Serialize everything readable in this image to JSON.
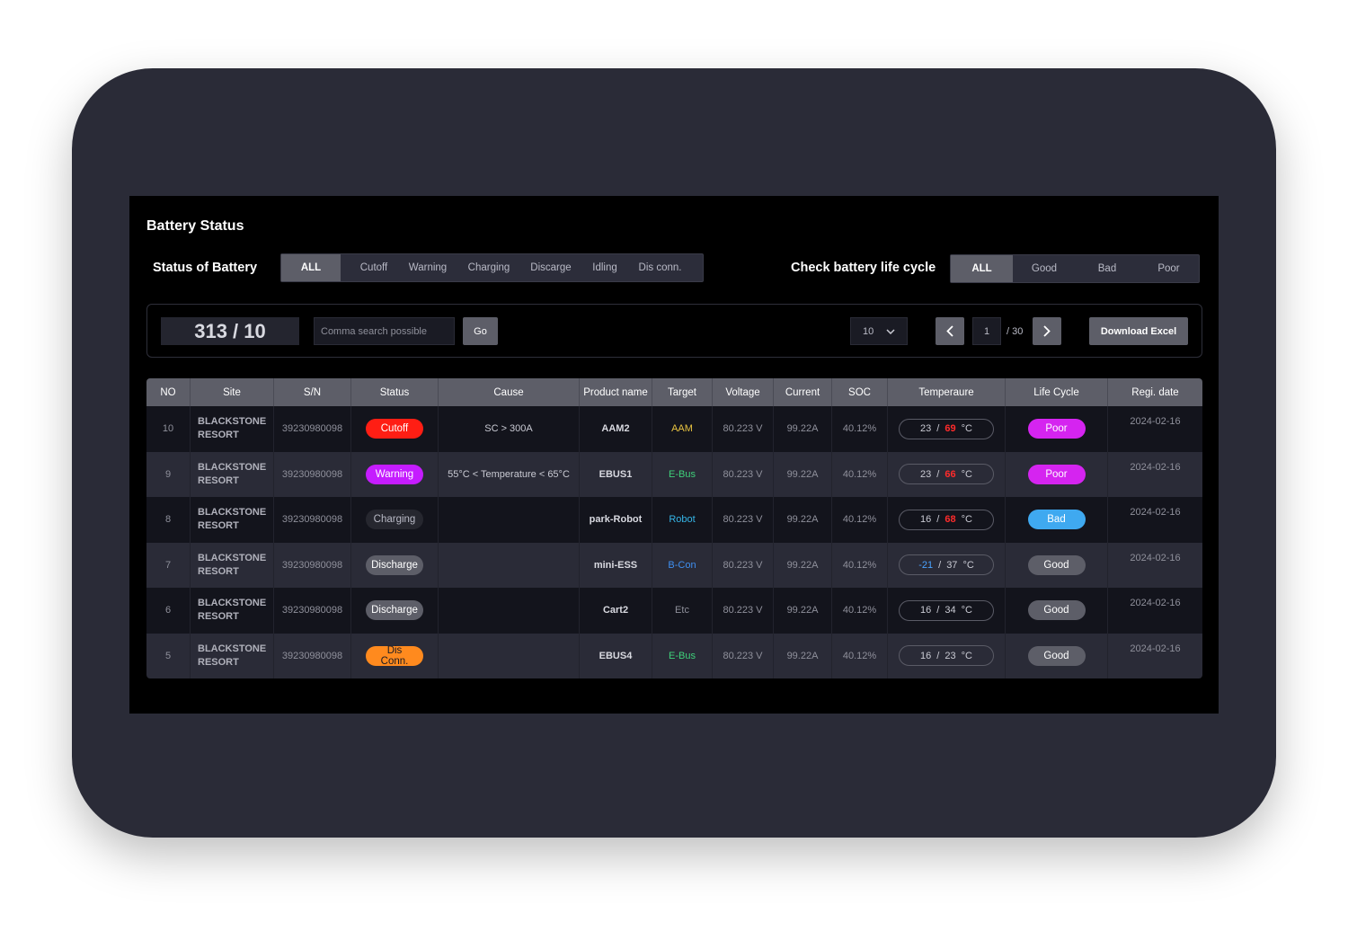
{
  "title": "Battery Status",
  "status_filter": {
    "label": "Status of Battery",
    "options": [
      "ALL",
      "Cutoff",
      "Warning",
      "Charging",
      "Discarge",
      "Idling",
      "Dis conn."
    ]
  },
  "life_filter": {
    "label": "Check battery life cycle",
    "options": [
      "ALL",
      "Good",
      "Bad",
      "Poor"
    ]
  },
  "toolbar": {
    "count": "313 / 10",
    "search_placeholder": "Comma search possible",
    "go_label": "Go",
    "per_page": "10",
    "page": "1",
    "total_pages": "/ 30",
    "download_label": "Download Excel"
  },
  "table": {
    "headers": [
      "NO",
      "Site",
      "S/N",
      "Status",
      "Cause",
      "Product name",
      "Target",
      "Voltage",
      "Current",
      "SOC",
      "Temperaure",
      "Life Cycle",
      "Regi. date"
    ],
    "rows": [
      {
        "no": "10",
        "site1": "BLACKSTONE",
        "site2": "RESORT",
        "sn": "39230980098",
        "status": "Cutoff",
        "cause": "SC > 300A",
        "product": "AAM2",
        "target": "AAM",
        "voltage": "80.223 V",
        "current": "99.22A",
        "soc": "40.12%",
        "t1": "23",
        "sep": "/",
        "t2": "69",
        "unit": "°C",
        "life": "Poor",
        "date": "2024-02-16"
      },
      {
        "no": "9",
        "site1": "BLACKSTONE",
        "site2": "RESORT",
        "sn": "39230980098",
        "status": "Warning",
        "cause": "55°C < Temperature < 65°C",
        "product": "EBUS1",
        "target": "E-Bus",
        "voltage": "80.223 V",
        "current": "99.22A",
        "soc": "40.12%",
        "t1": "23",
        "sep": "/",
        "t2": "66",
        "unit": "°C",
        "life": "Poor",
        "date": "2024-02-16"
      },
      {
        "no": "8",
        "site1": "BLACKSTONE",
        "site2": "RESORT",
        "sn": "39230980098",
        "status": "Charging",
        "cause": "",
        "product": "park-Robot",
        "target": "Robot",
        "voltage": "80.223 V",
        "current": "99.22A",
        "soc": "40.12%",
        "t1": "16",
        "sep": "/",
        "t2": "68",
        "unit": "°C",
        "life": "Bad",
        "date": "2024-02-16"
      },
      {
        "no": "7",
        "site1": "BLACKSTONE",
        "site2": "RESORT",
        "sn": "39230980098",
        "status": "Discharge",
        "cause": "",
        "product": "mini-ESS",
        "target": "B-Con",
        "voltage": "80.223 V",
        "current": "99.22A",
        "soc": "40.12%",
        "t1": "-21",
        "sep": "/",
        "t2": "37",
        "unit": "°C",
        "life": "Good",
        "date": "2024-02-16"
      },
      {
        "no": "6",
        "site1": "BLACKSTONE",
        "site2": "RESORT",
        "sn": "39230980098",
        "status": "Discharge",
        "cause": "",
        "product": "Cart2",
        "target": "Etc",
        "voltage": "80.223 V",
        "current": "99.22A",
        "soc": "40.12%",
        "t1": "16",
        "sep": "/",
        "t2": "34",
        "unit": "°C",
        "life": "Good",
        "date": "2024-02-16"
      },
      {
        "no": "5",
        "site1": "BLACKSTONE",
        "site2": "RESORT",
        "sn": "39230980098",
        "status": "Dis Conn.",
        "cause": "",
        "product": "EBUS4",
        "target": "E-Bus",
        "voltage": "80.223 V",
        "current": "99.22A",
        "soc": "40.12%",
        "t1": "16",
        "sep": "/",
        "t2": "23",
        "unit": "°C",
        "life": "Good",
        "date": "2024-02-16"
      }
    ]
  },
  "colors": {
    "cutoff": "#ff1e14",
    "warning": "#c51cff",
    "disconn": "#ff8a1e",
    "poor": "#d524f0",
    "bad": "#3fa9f0",
    "target_aam": "#e8c341",
    "target_ebus": "#3fd17a",
    "target_robot": "#35b6e8",
    "target_bcon": "#3f8ff0",
    "target_etc": "#8f909b"
  }
}
